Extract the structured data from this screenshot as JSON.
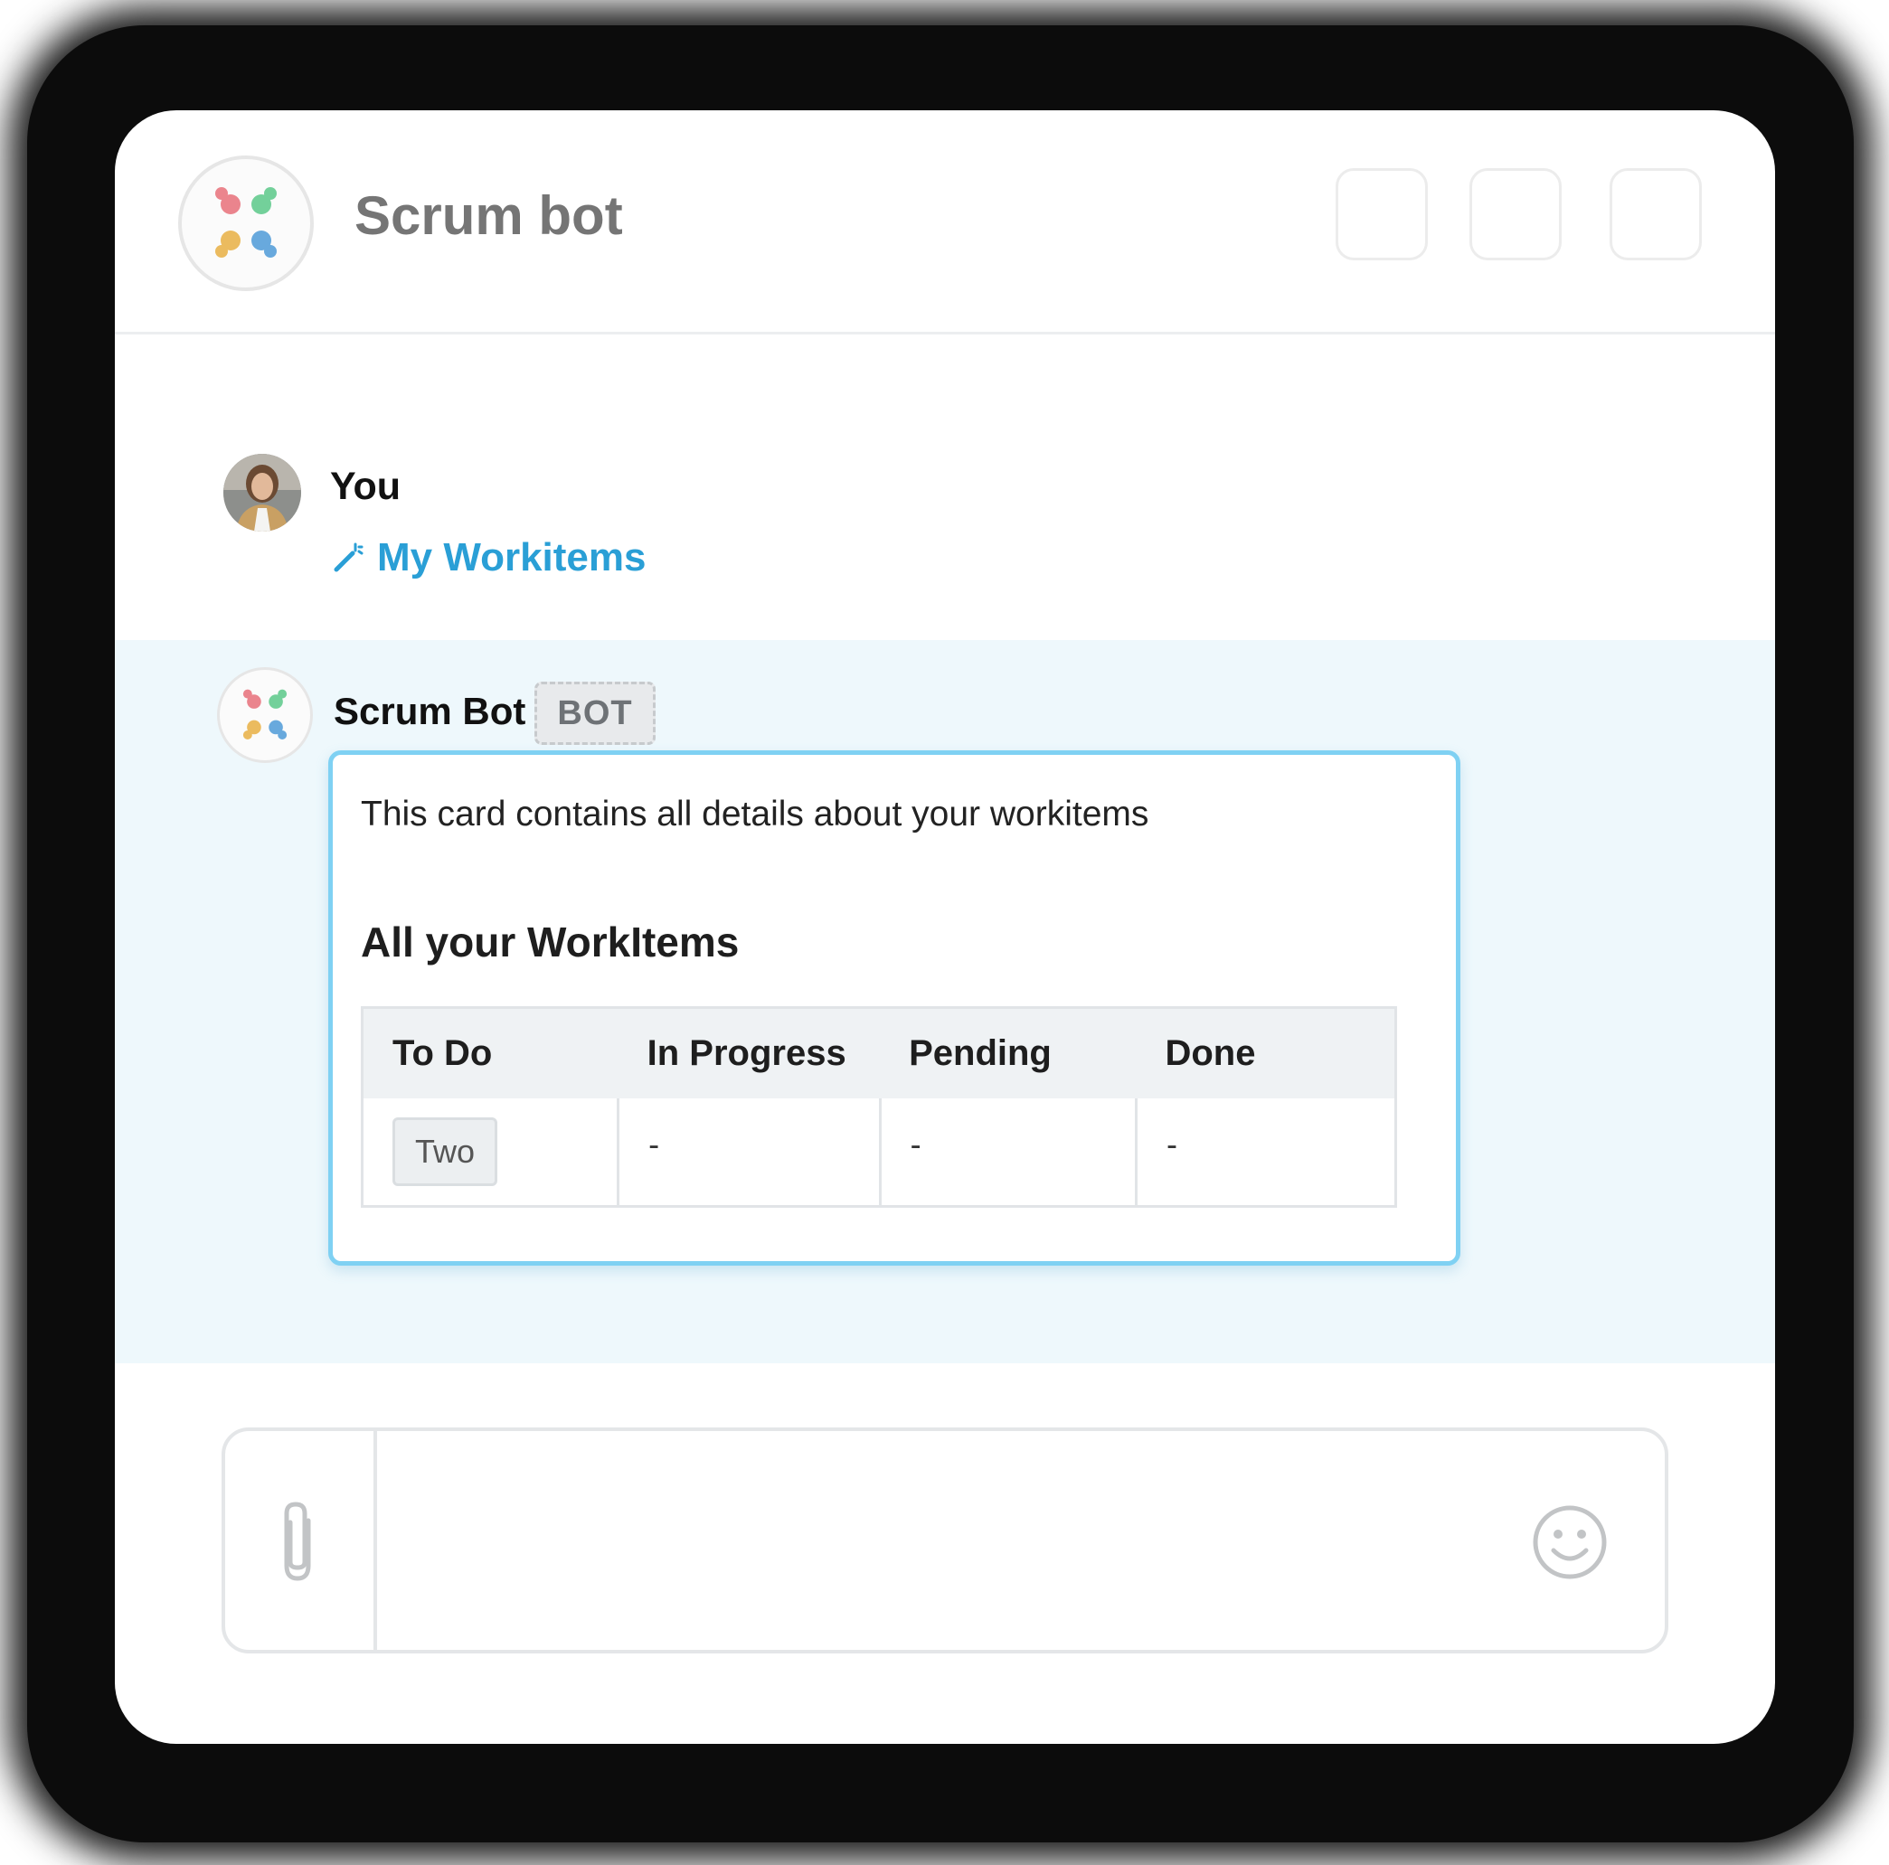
{
  "window": {
    "title": "Scrum bot",
    "header_buttons": [
      "",
      "",
      ""
    ]
  },
  "messages": {
    "user": {
      "sender": "You",
      "command_icon": "magic-wand-icon",
      "command_text": "My Workitems"
    },
    "bot": {
      "sender": "Scrum Bot",
      "badge": "BOT",
      "card": {
        "description": "This card contains all details about your workitems",
        "heading": "All your WorkItems",
        "columns": [
          "To Do",
          "In Progress",
          "Pending",
          "Done"
        ],
        "row": [
          "Two",
          "-",
          "-",
          "-"
        ]
      }
    }
  },
  "composer": {
    "attach_icon": "paperclip-icon",
    "emoji_icon": "smiley-icon",
    "placeholder": ""
  },
  "colors": {
    "link": "#2a9fd6",
    "bot_message_bg": "#eef8fc",
    "card_border": "#7fd1f3",
    "logo_red": "#e8707a",
    "logo_green": "#5cc98a",
    "logo_yellow": "#e9b144",
    "logo_blue": "#4f9bd8"
  }
}
